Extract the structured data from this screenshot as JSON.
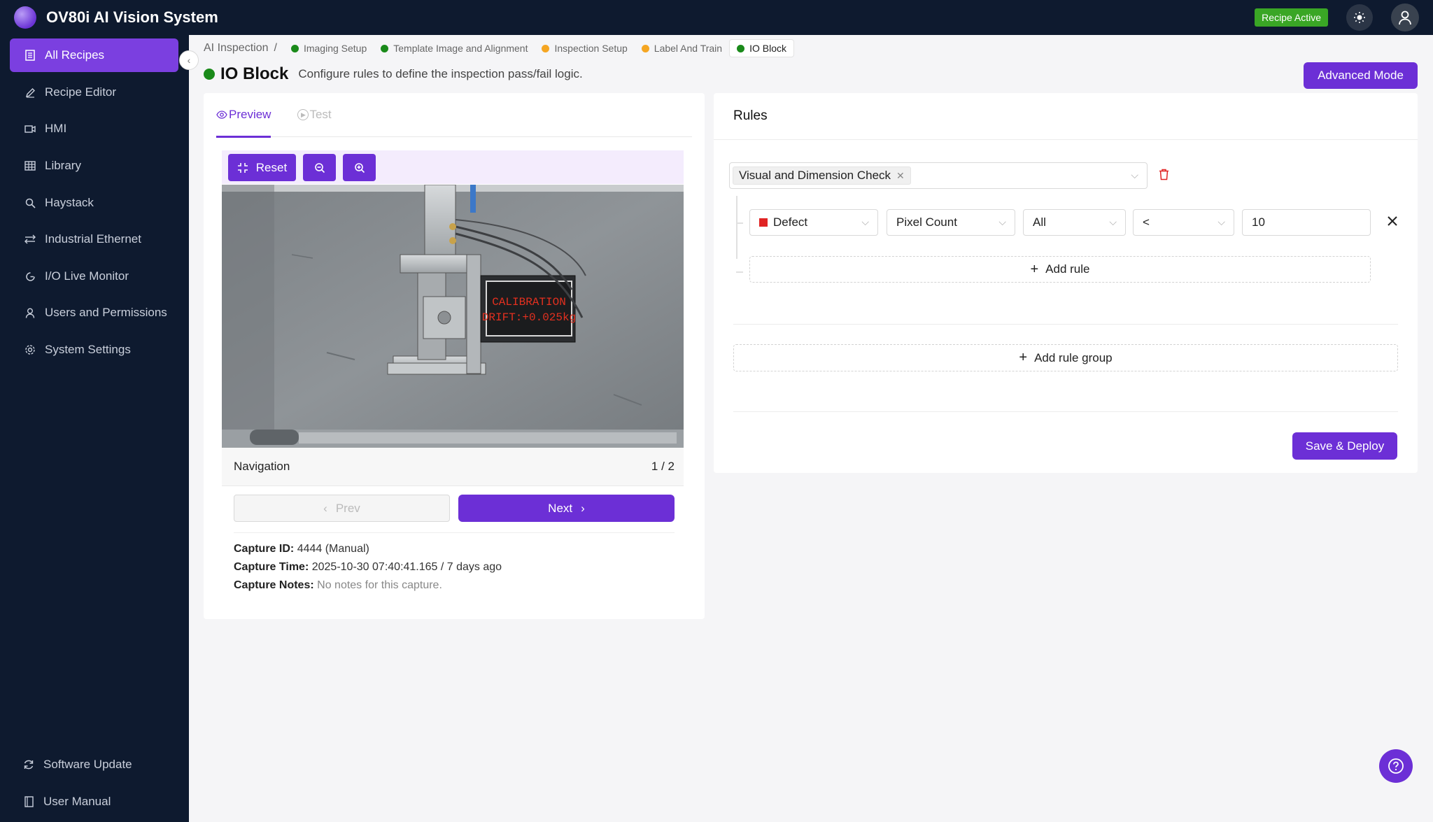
{
  "app": {
    "title": "OV80i AI Vision System",
    "status_badge": "Recipe Active"
  },
  "sidebar": {
    "items": [
      {
        "label": "All Recipes",
        "icon": "document-icon",
        "active": true
      },
      {
        "label": "Recipe Editor",
        "icon": "pencil-icon"
      },
      {
        "label": "HMI",
        "icon": "video-icon"
      },
      {
        "label": "Library",
        "icon": "table-icon"
      },
      {
        "label": "Haystack",
        "icon": "search-icon"
      },
      {
        "label": "Industrial Ethernet",
        "icon": "network-icon"
      },
      {
        "label": "I/O Live Monitor",
        "icon": "monitor-icon"
      },
      {
        "label": "Users and Permissions",
        "icon": "user-icon"
      },
      {
        "label": "System Settings",
        "icon": "gear-icon"
      }
    ],
    "bottom": [
      {
        "label": "Software Update",
        "icon": "refresh-icon"
      },
      {
        "label": "User Manual",
        "icon": "book-icon"
      }
    ]
  },
  "breadcrumb": {
    "root": "AI Inspection",
    "separator": "/",
    "steps": [
      {
        "label": "Imaging Setup",
        "status": "green"
      },
      {
        "label": "Template Image and Alignment",
        "status": "green"
      },
      {
        "label": "Inspection Setup",
        "status": "orange"
      },
      {
        "label": "Label And Train",
        "status": "orange"
      },
      {
        "label": "IO Block",
        "status": "green",
        "current": true
      }
    ]
  },
  "page": {
    "title": "IO Block",
    "subtitle": "Configure rules to define the inspection pass/fail logic.",
    "advanced_button": "Advanced Mode"
  },
  "preview": {
    "tabs": {
      "preview": "Preview",
      "test": "Test"
    },
    "reset_label": "Reset",
    "image_text_line1": "CALIBRATION",
    "image_text_line2": "DRIFT:+0.025kg",
    "navigation_label": "Navigation",
    "page_indicator": "1 / 2",
    "prev_label": "Prev",
    "next_label": "Next",
    "capture_id_label": "Capture ID:",
    "capture_id_value": "4444 (Manual)",
    "capture_time_label": "Capture Time:",
    "capture_time_value": "2025-10-30 07:40:41.165 / 7 days ago",
    "capture_notes_label": "Capture Notes:",
    "capture_notes_value": "No notes for this capture."
  },
  "rules": {
    "title": "Rules",
    "group_tag": "Visual and Dimension Check",
    "rule": {
      "class": "Defect",
      "class_color": "#e02424",
      "metric": "Pixel Count",
      "scope": "All",
      "operator": "<",
      "value": "10"
    },
    "add_rule": "Add rule",
    "add_rule_group": "Add rule group",
    "save_deploy": "Save & Deploy"
  },
  "colors": {
    "accent": "#6c2fd6",
    "nav_bg": "#0e1a2f",
    "status_green": "#1a8a1a",
    "status_orange": "#f5a623"
  }
}
